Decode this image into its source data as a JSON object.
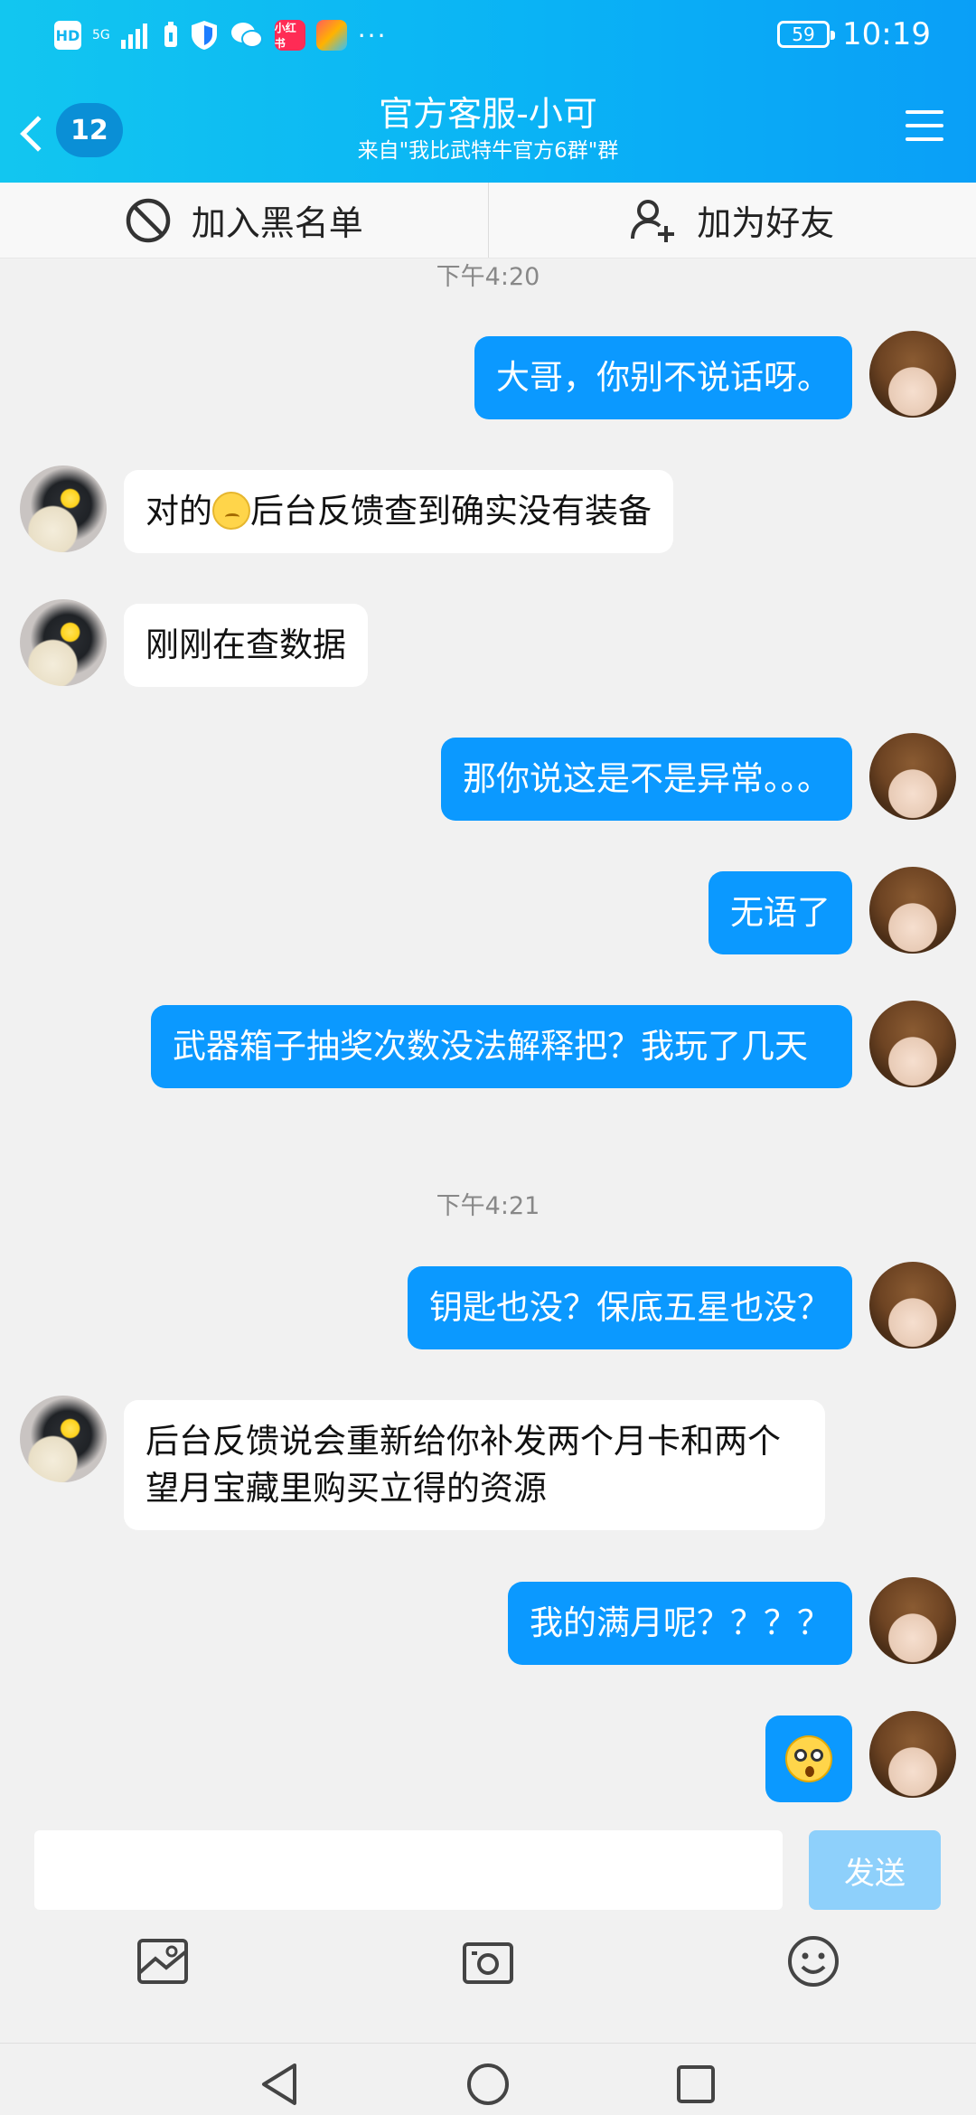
{
  "status_bar": {
    "hd": "HD",
    "network": "5G",
    "red_app": "小红书",
    "dots": "···",
    "battery": "59",
    "time": "10:19"
  },
  "header": {
    "unread_count": "12",
    "title": "官方客服-小可",
    "subtitle": "来自\"我比武特牛官方6群\"群"
  },
  "actions": {
    "blacklist": "加入黑名单",
    "add_friend": "加为好友"
  },
  "messages": {
    "time1": "下午4:20",
    "m1": "大哥，你别不说话呀。",
    "m2_pre": "对的",
    "m2_post": "后台反馈查到确实没有装备",
    "m3": "刚刚在查数据",
    "m4": "那你说这是不是异常。。。",
    "m5": "无语了",
    "m6": "武器箱子抽奖次数没法解释把？我玩了几天",
    "time2": "下午4:21",
    "m7": "钥匙也没？保底五星也没？",
    "m8": "后台反馈说会重新给你补发两个月卡和两个望月宝藏里购买立得的资源",
    "m9": "我的满月呢？？？？"
  },
  "input": {
    "value": "",
    "send_label": "发送"
  },
  "colors": {
    "accent": "#0b99ff",
    "header_start": "#12c6f0",
    "header_end": "#0a9ff7",
    "send_disabled": "#8ed0fb"
  }
}
